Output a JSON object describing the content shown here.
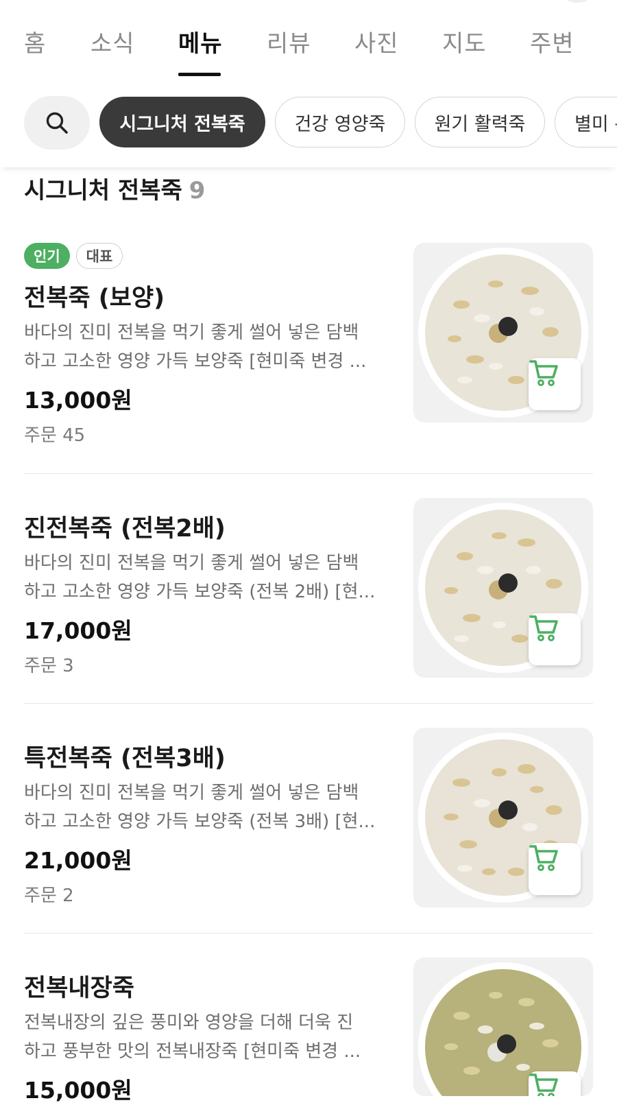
{
  "tabs": [
    {
      "label": "홈"
    },
    {
      "label": "소식"
    },
    {
      "label": "메뉴",
      "active": true
    },
    {
      "label": "리뷰"
    },
    {
      "label": "사진"
    },
    {
      "label": "지도"
    },
    {
      "label": "주변"
    }
  ],
  "chips": {
    "search_icon": "search-icon",
    "items": [
      {
        "label": "시그니처 전복죽",
        "active": true
      },
      {
        "label": "건강 영양죽"
      },
      {
        "label": "원기 활력죽"
      },
      {
        "label": "별미 특"
      }
    ]
  },
  "section": {
    "title": "시그니처 전복죽",
    "count": "9"
  },
  "menu": [
    {
      "badges": [
        "인기",
        "대표"
      ],
      "name": "전복죽 (보양)",
      "desc1": "바다의 진미 전복을 먹기 좋게 썰어 넣은 담백",
      "desc2": "하고 고소한 영양 가득 보양죽 [현미죽 변경 ...",
      "price": "13,000원",
      "orders": "주문 45",
      "image_color": "#ece7db"
    },
    {
      "name": "진전복죽 (전복2배)",
      "desc1": "바다의 진미 전복을 먹기 좋게 썰어 넣은 담백",
      "desc2": "하고 고소한 영양 가득 보양죽 (전복 2배) [현...",
      "price": "17,000원",
      "orders": "주문 3",
      "image_color": "#ece7db"
    },
    {
      "name": "특전복죽 (전복3배)",
      "desc1": "바다의 진미 전복을 먹기 좋게 썰어 넣은 담백",
      "desc2": "하고 고소한 영양 가득 보양죽 (전복 3배) [현...",
      "price": "21,000원",
      "orders": "주문 2",
      "image_color": "#ece7db"
    },
    {
      "name": "전복내장죽",
      "desc1": "전복내장의 깊은 풍미와 영양을 더해 더욱 진",
      "desc2": "하고 풍부한 맛의 전복내장죽 [현미죽 변경 ...",
      "price": "15,000원",
      "image_color": "#b9b57e"
    }
  ],
  "colors": {
    "accent_green": "#4caf61",
    "chip_active": "#3a3a3a"
  }
}
